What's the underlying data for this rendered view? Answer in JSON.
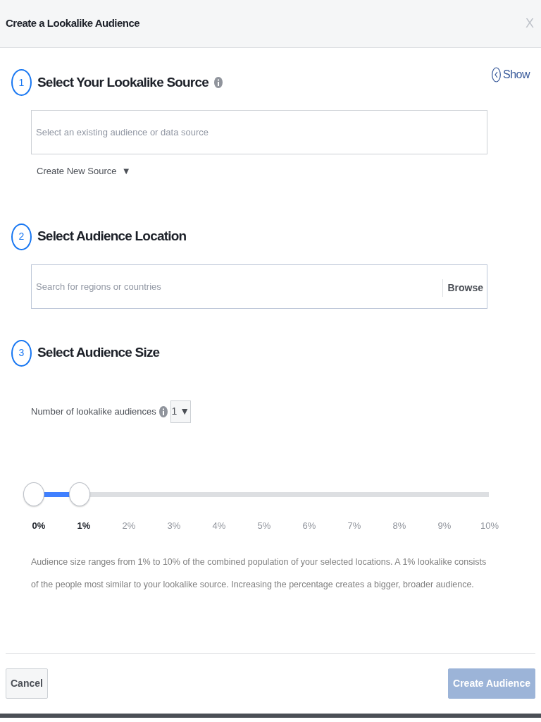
{
  "dialog": {
    "title": "Create a Lookalike Audience",
    "close": "X"
  },
  "show_link": {
    "label": "Show"
  },
  "steps": [
    {
      "number": "1",
      "title": "Select Your Lookalike Source",
      "info": true,
      "field": {
        "placeholder": "Select an existing audience or data source"
      },
      "link": {
        "label": "Create New Source",
        "caret": "▼"
      }
    },
    {
      "number": "2",
      "title": "Select Audience Location",
      "info": false,
      "field": {
        "placeholder": "Search for regions or countries",
        "button": "Browse"
      }
    },
    {
      "number": "3",
      "title": "Select Audience Size",
      "info": false
    }
  ],
  "audience_count": {
    "label": "Number of lookalike audiences",
    "value": "1",
    "caret": "▼"
  },
  "size_slider": {
    "level": 0.1,
    "ticks": [
      {
        "label": "0%",
        "in_range": true
      },
      {
        "label": "1%",
        "in_range": true
      },
      {
        "label": "2%",
        "in_range": false
      },
      {
        "label": "3%",
        "in_range": false
      },
      {
        "label": "4%",
        "in_range": false
      },
      {
        "label": "5%",
        "in_range": false
      },
      {
        "label": "6%",
        "in_range": false
      },
      {
        "label": "7%",
        "in_range": false
      },
      {
        "label": "8%",
        "in_range": false
      },
      {
        "label": "9%",
        "in_range": false
      },
      {
        "label": "10%",
        "in_range": false
      }
    ]
  },
  "description": "Audience size ranges from 1% to 10% of the combined population of your selected locations. A 1% lookalike consists of the people most similar to your lookalike source. Increasing the percentage creates a bigger, broader audience.",
  "buttons": [
    {
      "label": "Cancel",
      "kind": "secondary",
      "disabled": false
    },
    {
      "label": "Create Audience",
      "kind": "primary",
      "disabled": true
    }
  ]
}
